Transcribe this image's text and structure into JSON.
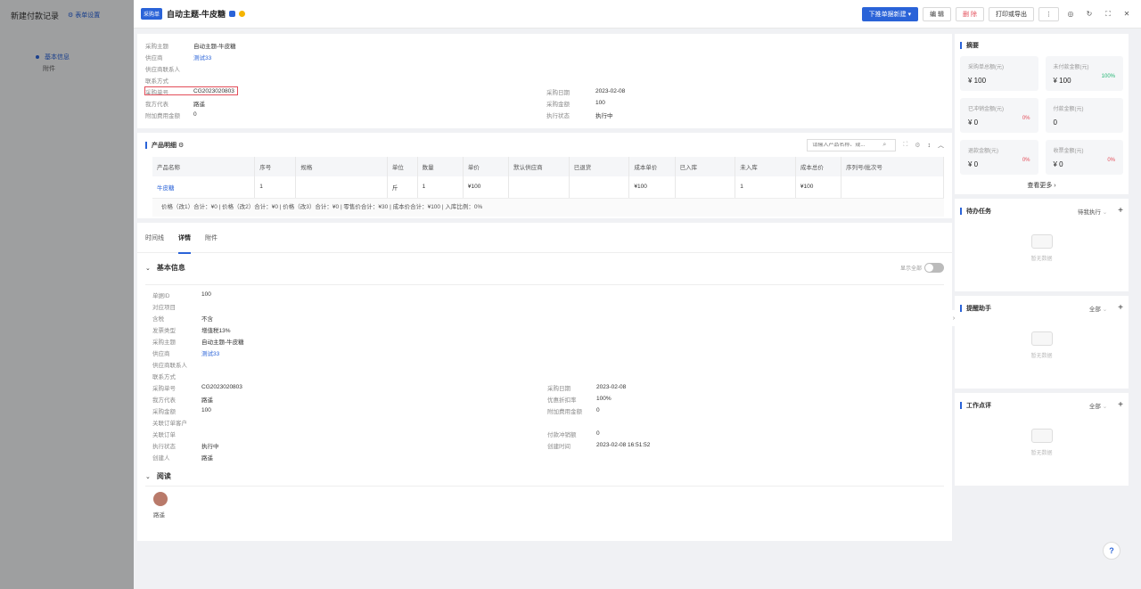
{
  "background": {
    "title": "新建付款记录",
    "settings": "表单设置",
    "nav": [
      "基本信息",
      "附件"
    ]
  },
  "header": {
    "tag": "采购单",
    "title": "自动主题-牛皮糖",
    "btn_push": "下推单据新建",
    "btn_edit": "编 辑",
    "btn_delete": "删 除",
    "btn_print": "打印或导出",
    "btn_more": "⋮"
  },
  "top_fields": {
    "left": [
      {
        "label": "采购主题",
        "value": "自动主题-牛皮糖"
      },
      {
        "label": "供应商",
        "value": "测试33"
      },
      {
        "label": "供应商联系人",
        "value": ""
      },
      {
        "label": "联系方式",
        "value": ""
      },
      {
        "label": "采购单号",
        "value": "CG2023020803"
      },
      {
        "label": "我方代表",
        "value": "路遥"
      },
      {
        "label": "附加费用金额",
        "value": "0"
      }
    ],
    "right": [
      {
        "label": "采购日期",
        "value": "2023-02-08"
      },
      {
        "label": "采购金额",
        "value": "100"
      },
      {
        "label": "执行状态",
        "value": "执行中"
      }
    ]
  },
  "products": {
    "title": "产品明细",
    "search_placeholder": "请输入产品名称、规...",
    "columns": [
      "产品名称",
      "序号",
      "规格",
      "单位",
      "数量",
      "单价",
      "默认供应商",
      "已退货",
      "成本单价",
      "已入库",
      "未入库",
      "成本总价",
      "序列号/批次号"
    ],
    "rows": [
      [
        "牛皮糖",
        "1",
        "",
        "斤",
        "1",
        "¥100",
        "",
        "",
        "¥100",
        "",
        "1",
        "¥100",
        ""
      ]
    ],
    "summary": "价格（改1）合计：¥0 |   价格（改2）合计：¥0 |   价格（改3）合计：¥0 |   零售价合计：¥30 |   成本价合计：¥100 |   入库比例：0%"
  },
  "tabs": [
    "时间线",
    "详情",
    "附件"
  ],
  "basic": {
    "title": "基本信息",
    "show_all": "显示全部",
    "left": [
      {
        "label": "单据ID",
        "value": "100"
      },
      {
        "label": "对应项目",
        "value": ""
      },
      {
        "label": "含税",
        "value": "不含"
      },
      {
        "label": "发票类型",
        "value": "增值税13%"
      },
      {
        "label": "采购主题",
        "value": "自动主题-牛皮糖"
      },
      {
        "label": "供应商",
        "value": "测试33"
      },
      {
        "label": "供应商联系人",
        "value": ""
      },
      {
        "label": "联系方式",
        "value": ""
      },
      {
        "label": "采购单号",
        "value": "CG2023020803"
      },
      {
        "label": "我方代表",
        "value": "路遥"
      },
      {
        "label": "采购金额",
        "value": "100"
      },
      {
        "label": "关联订单客户",
        "value": ""
      },
      {
        "label": "关联订单",
        "value": ""
      },
      {
        "label": "执行状态",
        "value": "执行中"
      },
      {
        "label": "创建人",
        "value": "路遥"
      }
    ],
    "right": [
      {
        "label": "采购日期",
        "value": "2023-02-08"
      },
      {
        "label": "优惠折扣率",
        "value": "100%"
      },
      {
        "label": "附加费用金额",
        "value": "0"
      },
      {
        "label": "",
        "value": ""
      },
      {
        "label": "付款冲销额",
        "value": "0"
      },
      {
        "label": "创建时间",
        "value": "2023-02-08 16:51:52"
      }
    ]
  },
  "read": {
    "title": "阅读",
    "user": "路遥"
  },
  "summary": {
    "title": "摘要",
    "stats": [
      {
        "label": "采购单总额(元)",
        "value": "¥ 100",
        "pct": ""
      },
      {
        "label": "未付款金额(元)",
        "value": "¥ 100",
        "pct": "100%"
      },
      {
        "label": "已冲销金额(元)",
        "value": "¥ 0",
        "pct": "0%"
      },
      {
        "label": "付款金额(元)",
        "value": "0",
        "pct": ""
      },
      {
        "label": "退款金额(元)",
        "value": "¥ 0",
        "pct": "0%"
      },
      {
        "label": "收票金额(元)",
        "value": "¥ 0",
        "pct": "0%"
      }
    ],
    "more": "查看更多"
  },
  "panels": [
    {
      "title": "待办任务",
      "filter": "待我执行",
      "empty": "暂无数据"
    },
    {
      "title": "提醒助手",
      "filter": "全部",
      "empty": "暂无数据"
    },
    {
      "title": "工作点评",
      "filter": "全部",
      "empty": "暂无数据"
    }
  ],
  "colors": {
    "accent": "#2a63d8",
    "danger": "#e34d59",
    "positive": "#22b573"
  }
}
